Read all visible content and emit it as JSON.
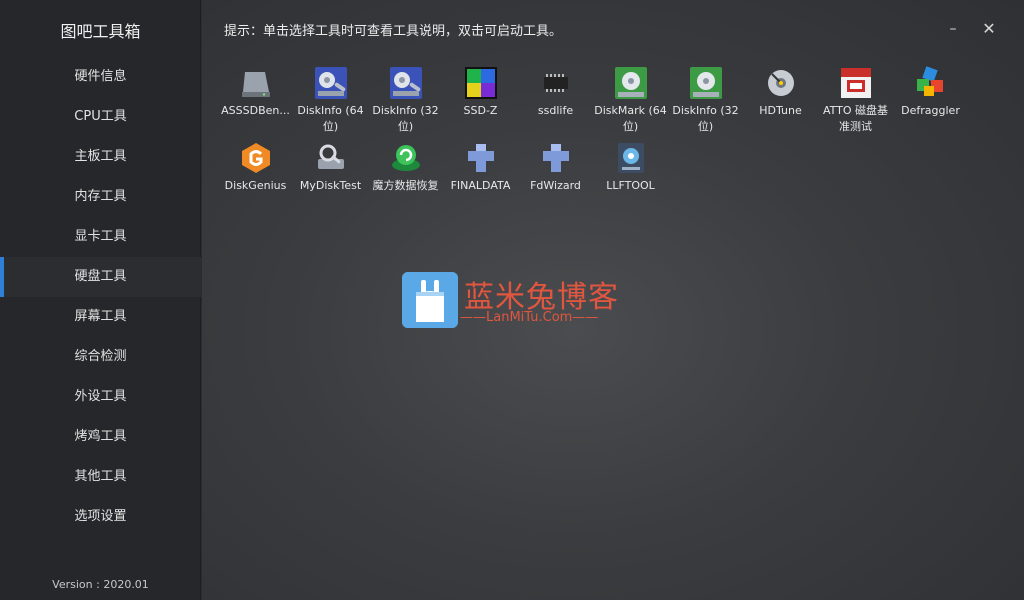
{
  "app": {
    "title": "图吧工具箱",
    "version": "Version : 2020.01"
  },
  "header": {
    "hint": "提示：单击选择工具时可查看工具说明，双击可启动工具。",
    "minimize_label": "–",
    "close_label": "✕"
  },
  "sidebar": {
    "active_index": 5,
    "items": [
      {
        "label": "硬件信息"
      },
      {
        "label": "CPU工具"
      },
      {
        "label": "主板工具"
      },
      {
        "label": "内存工具"
      },
      {
        "label": "显卡工具"
      },
      {
        "label": "硬盘工具"
      },
      {
        "label": "屏幕工具"
      },
      {
        "label": "综合检测"
      },
      {
        "label": "外设工具"
      },
      {
        "label": "烤鸡工具"
      },
      {
        "label": "其他工具"
      },
      {
        "label": "选项设置"
      }
    ]
  },
  "tools": [
    {
      "label": "ASSSDBen...",
      "icon": "drive-icon"
    },
    {
      "label": "DiskInfo (64位)",
      "icon": "diskinfo-icon"
    },
    {
      "label": "DiskInfo (32位)",
      "icon": "diskinfo-icon"
    },
    {
      "label": "SSD-Z",
      "icon": "ssdz-icon"
    },
    {
      "label": "ssdlife",
      "icon": "chip-icon"
    },
    {
      "label": "DiskMark (64位)",
      "icon": "diskmark-icon"
    },
    {
      "label": "DiskInfo (32位)",
      "icon": "diskmark-icon"
    },
    {
      "label": "HDTune",
      "icon": "hdd-icon"
    },
    {
      "label": "ATTO 磁盘基准测试",
      "icon": "atto-icon"
    },
    {
      "label": "Defraggler",
      "icon": "defraggler-icon"
    },
    {
      "label": "DiskGenius",
      "icon": "diskgenius-icon"
    },
    {
      "label": "MyDiskTest",
      "icon": "magnifier-drive-icon"
    },
    {
      "label": "魔方数据恢复",
      "icon": "recovery-icon"
    },
    {
      "label": "FINALDATA",
      "icon": "puzzle-icon"
    },
    {
      "label": "FdWizard",
      "icon": "puzzle-icon"
    },
    {
      "label": "LLFTOOL",
      "icon": "llftool-icon"
    }
  ],
  "watermark": {
    "title": "蓝米兔博客",
    "subtitle": "——LanMiTu.Com——"
  },
  "colors": {
    "accent": "#2f7fd6",
    "sidebar_bg": "#26272a",
    "watermark": "#e0563f"
  }
}
